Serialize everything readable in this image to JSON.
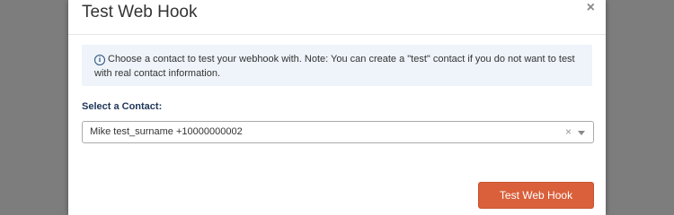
{
  "modal": {
    "title": "Test Web Hook",
    "close_glyph": "×",
    "info_icon": "info-circle-icon",
    "info_icon_glyph": "i",
    "info_text": "Choose a contact to test your webhook with. Note: You can create a \"test\" contact if you do not want to test with real contact information.",
    "select_label": "Select a Contact:",
    "select_value": "Mike test_surname +10000000002",
    "select_clear_glyph": "×",
    "submit_label": "Test Web Hook"
  },
  "colors": {
    "accent": "#d9603b",
    "info_background": "#eef4fa",
    "label_color": "#1e3558",
    "backdrop": "#808080"
  }
}
